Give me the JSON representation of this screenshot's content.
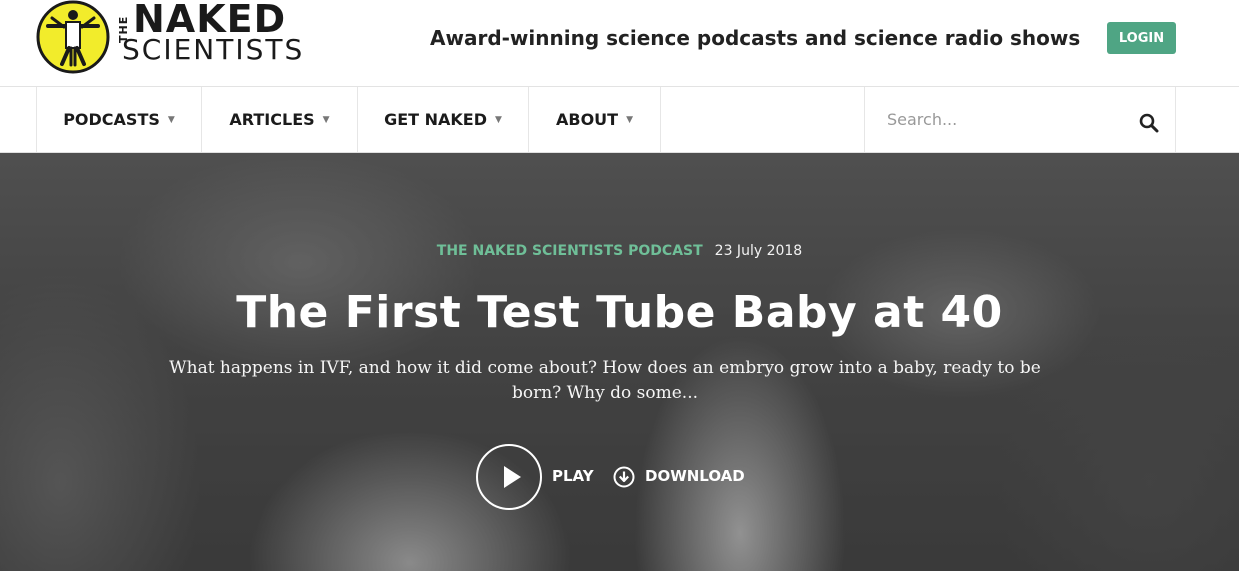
{
  "header": {
    "logo_the": "THE",
    "logo_naked": "NAKED",
    "logo_scientists": "SCIENTISTS",
    "tagline": "Award-winning science podcasts and science radio shows",
    "login_label": "LOGIN"
  },
  "nav": {
    "items": [
      {
        "label": "PODCASTS"
      },
      {
        "label": "ARTICLES"
      },
      {
        "label": "GET NAKED"
      },
      {
        "label": "ABOUT"
      }
    ],
    "search_placeholder": "Search..."
  },
  "hero": {
    "category": "THE NAKED SCIENTISTS PODCAST",
    "date": "23 July 2018",
    "title": "The First Test Tube Baby at 40",
    "description": "What happens in IVF, and how it did come about? How does an embryo grow into a baby, ready to be born? Why do some...",
    "play_label": "PLAY",
    "download_label": "DOWNLOAD"
  },
  "colors": {
    "accent_green": "#4fa584",
    "category_green": "#6fbf98",
    "logo_yellow": "#f2ec2b"
  },
  "icons": {
    "logo": "vitruvian-scientist-logo-icon",
    "search": "search-icon",
    "play": "play-icon",
    "download": "download-icon",
    "caret": "caret-down-icon"
  }
}
